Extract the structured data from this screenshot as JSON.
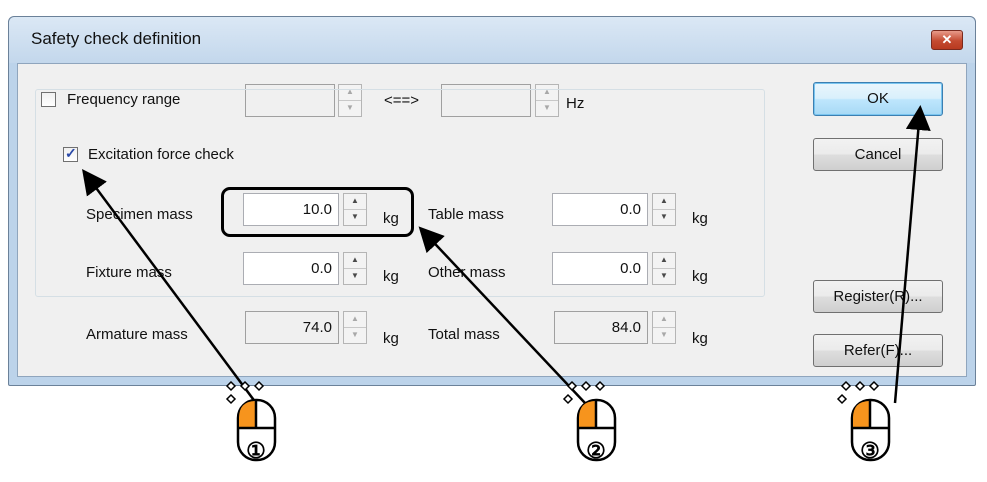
{
  "dialog": {
    "title": "Safety check definition",
    "close_glyph": "✕"
  },
  "frequency": {
    "label": "Frequency range",
    "checked": false,
    "from_value": "",
    "to_value": "",
    "separator": "<==>",
    "unit": "Hz"
  },
  "excitation": {
    "label": "Excitation force check",
    "checked": true,
    "unit": "kg",
    "fields": {
      "specimen": {
        "label": "Specimen mass",
        "value": "10.0"
      },
      "table": {
        "label": "Table mass",
        "value": "0.0"
      },
      "fixture": {
        "label": "Fixture  mass",
        "value": "0.0"
      },
      "other": {
        "label": "Other mass",
        "value": "0.0"
      },
      "armature": {
        "label": "Armature mass",
        "value": "74.0"
      },
      "total": {
        "label": "Total mass",
        "value": "84.0"
      }
    }
  },
  "buttons": {
    "ok": "OK",
    "cancel": "Cancel",
    "register": "Register(R)...",
    "refer": "Refer(F)..."
  },
  "callouts": {
    "first": "①",
    "second": "②",
    "third": "③",
    "mouse_accent": "#f7941d"
  },
  "icons": {
    "spin_up": "▲",
    "spin_down": "▼"
  }
}
